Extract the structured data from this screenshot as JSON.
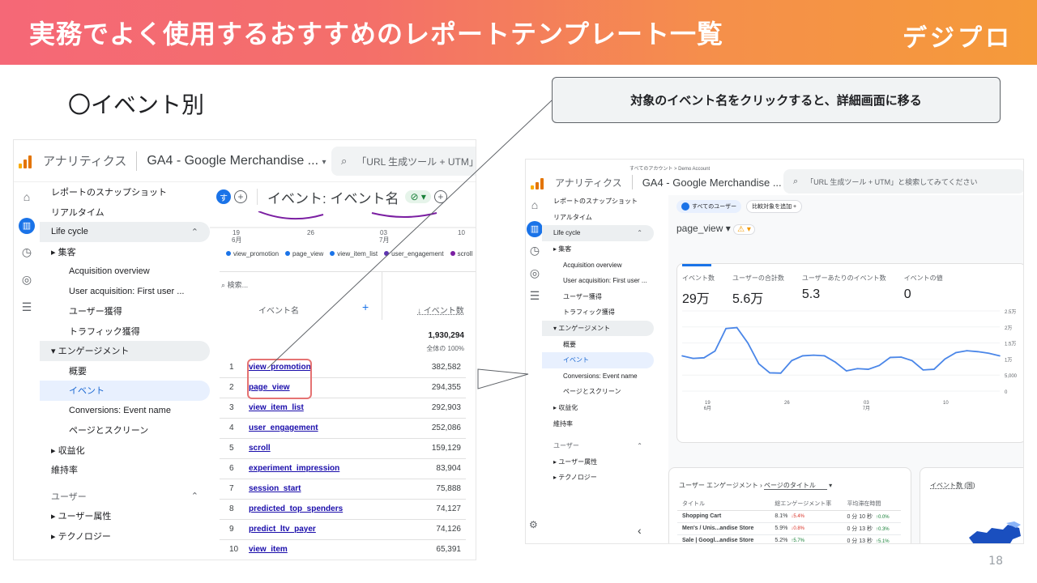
{
  "slide": {
    "banner_title": "実務でよく使用するおすすめのレポートテンプレート一覧",
    "logo": "デジプロ",
    "section_title": "〇イベント別",
    "callout": "対象のイベント名をクリックすると、詳細画面に移る",
    "page_number": "18",
    "accent_color": "#f5904a",
    "highlight_color": "#e57373"
  },
  "shot1": {
    "app_name": "アナリティクス",
    "property": "GA4 - Google Merchandise ...",
    "search_text": "「URL 生成ツール + UTM」",
    "nav": [
      {
        "label": "レポートのスナップショット",
        "kind": "top"
      },
      {
        "label": "リアルタイム",
        "kind": "top"
      },
      {
        "label": "Life cycle",
        "kind": "group"
      },
      {
        "label": "▸ 集客",
        "kind": "top"
      },
      {
        "label": "Acquisition overview",
        "kind": "sub"
      },
      {
        "label": "User acquisition: First user ...",
        "kind": "sub"
      },
      {
        "label": "ユーザー獲得",
        "kind": "sub"
      },
      {
        "label": "トラフィック獲得",
        "kind": "sub"
      },
      {
        "label": "▾ エンゲージメント",
        "kind": "group-item"
      },
      {
        "label": "概要",
        "kind": "sub"
      },
      {
        "label": "イベント",
        "kind": "sel"
      },
      {
        "label": "Conversions: Event name",
        "kind": "sub"
      },
      {
        "label": "ページとスクリーン",
        "kind": "sub"
      },
      {
        "label": "▸ 収益化",
        "kind": "top"
      },
      {
        "label": "維持率",
        "kind": "top"
      },
      {
        "label": "ユーザー",
        "kind": "hdr"
      },
      {
        "label": "▸ ユーザー属性",
        "kind": "top"
      },
      {
        "label": "▸ テクノロジー",
        "kind": "top"
      }
    ],
    "avatar": "す",
    "report_title": "イベント: イベント名",
    "axis_ticks": [
      "19\n6月",
      "26",
      "03\n7月",
      "10"
    ],
    "legend": [
      {
        "label": "view_promotion",
        "color": "#1a73e8"
      },
      {
        "label": "page_view",
        "color": "#1a73e8"
      },
      {
        "label": "view_item_list",
        "color": "#1a73e8"
      },
      {
        "label": "user_engagement",
        "color": "#5e35b1"
      },
      {
        "label": "scroll",
        "color": "#7b1fa2"
      }
    ],
    "search_placeholder": "検索...",
    "col_event": "イベント名",
    "col_count": "↓ イベント数",
    "total": "1,930,294",
    "total_pct": "全体の 100%",
    "rows": [
      {
        "rank": "1",
        "name": "view_promotion",
        "count": "382,582"
      },
      {
        "rank": "2",
        "name": "page_view",
        "count": "294,355"
      },
      {
        "rank": "3",
        "name": "view_item_list",
        "count": "292,903"
      },
      {
        "rank": "4",
        "name": "user_engagement",
        "count": "252,086"
      },
      {
        "rank": "5",
        "name": "scroll",
        "count": "159,129"
      },
      {
        "rank": "6",
        "name": "experiment_impression",
        "count": "83,904"
      },
      {
        "rank": "7",
        "name": "session_start",
        "count": "75,888"
      },
      {
        "rank": "8",
        "name": "predicted_top_spenders",
        "count": "74,127"
      },
      {
        "rank": "9",
        "name": "predict_ltv_payer",
        "count": "74,126"
      },
      {
        "rank": "10",
        "name": "view_item",
        "count": "65,391"
      }
    ]
  },
  "shot2": {
    "breadcrumb": "すべてのアカウント > Demo Account",
    "app_name": "アナリティクス",
    "property": "GA4 - Google Merchandise ...",
    "search_text": "「URL 生成ツール + UTM」と検索してみてください",
    "nav": [
      {
        "label": "レポートのスナップショット",
        "kind": "top"
      },
      {
        "label": "リアルタイム",
        "kind": "top"
      },
      {
        "label": "Life cycle",
        "kind": "group"
      },
      {
        "label": "▸ 集客",
        "kind": "top"
      },
      {
        "label": "Acquisition overview",
        "kind": "sub"
      },
      {
        "label": "User acquisition: First user ...",
        "kind": "sub"
      },
      {
        "label": "ユーザー獲得",
        "kind": "sub"
      },
      {
        "label": "トラフィック獲得",
        "kind": "sub"
      },
      {
        "label": "▾ エンゲージメント",
        "kind": "group-item"
      },
      {
        "label": "概要",
        "kind": "sub"
      },
      {
        "label": "イベント",
        "kind": "sel"
      },
      {
        "label": "Conversions: Event name",
        "kind": "sub"
      },
      {
        "label": "ページとスクリーン",
        "kind": "sub"
      },
      {
        "label": "▸ 収益化",
        "kind": "top"
      },
      {
        "label": "維持率",
        "kind": "top"
      },
      {
        "label": "ユーザー",
        "kind": "hdr"
      },
      {
        "label": "▸ ユーザー属性",
        "kind": "top"
      },
      {
        "label": "▸ テクノロジー",
        "kind": "top"
      }
    ],
    "chip_all_users": "すべてのユーザー",
    "chip_compare": "比較対象を追加 +",
    "event_selector": "page_view",
    "kpis": [
      {
        "label": "イベント数",
        "value": "29万"
      },
      {
        "label": "ユーザーの合計数",
        "value": "5.6万"
      },
      {
        "label": "ユーザーあたりのイベント数",
        "value": "5.3"
      },
      {
        "label": "イベントの値",
        "value": "0"
      }
    ],
    "engagement_title": "ユーザー エンゲージメント",
    "engagement_sub": "ページのタイトル",
    "eng_cols": [
      "タイトル",
      "総エンゲージメント率",
      "平均滞在時間"
    ],
    "eng_rows": [
      {
        "title": "Shopping Cart",
        "rate": "8.1%",
        "delta": "↓5.4%",
        "time": "0 分 10 秒",
        "tdelta": "↑0.0%"
      },
      {
        "title": "Men's / Unis...andise Store",
        "rate": "5.9%",
        "delta": "↓0.8%",
        "time": "0 分 13 秒",
        "tdelta": "↑0.3%"
      },
      {
        "title": "Sale | Googl...andise Store",
        "rate": "5.2%",
        "delta": "↑5.7%",
        "time": "0 分 13 秒",
        "tdelta": "↑5.1%"
      }
    ],
    "country_card_title": "イベント数 (国)",
    "collapse_glyph": "‹"
  },
  "chart_data": {
    "type": "line",
    "x_ticks": [
      "19\n6月",
      "26",
      "03\n7月",
      "10"
    ],
    "y_ticks": [
      "2.5万",
      "2万",
      "1.5万",
      "1万",
      "5,000",
      "0"
    ],
    "ylim": [
      0,
      25000
    ],
    "series": [
      {
        "values": [
          11000,
          10200,
          10400,
          12500,
          19500,
          19800,
          15000,
          8500,
          5700,
          5600,
          9500,
          11000,
          11200,
          11000,
          9000,
          6300,
          7000,
          6800,
          8000,
          10500,
          10600,
          9500,
          6600,
          6800,
          10000,
          12000,
          12600,
          12300,
          11800,
          11000
        ],
        "color": "#4a86e8"
      }
    ],
    "grid": true
  }
}
